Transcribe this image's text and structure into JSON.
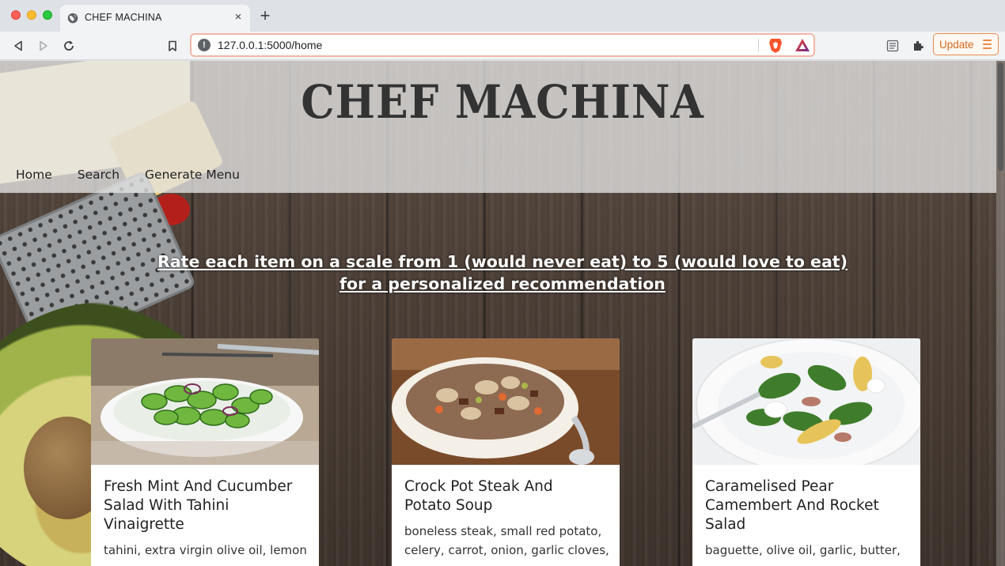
{
  "browser": {
    "tab_title": "CHEF MACHINA",
    "tab_close": "×",
    "new_tab": "+",
    "url": "127.0.0.1:5000/home",
    "update_label": "Update",
    "icons": [
      "back-icon",
      "forward-icon",
      "reload-icon",
      "bookmark-icon",
      "info-icon",
      "brave-shield-icon",
      "brave-rewards-icon",
      "reader-mode-icon",
      "extensions-icon",
      "menu-icon",
      "globe-icon"
    ]
  },
  "site": {
    "title": "CHEF MACHINA",
    "nav": [
      "Home",
      "Search",
      "Generate Menu"
    ]
  },
  "instructions": {
    "line1": "Rate each item on a scale from 1 (would never eat) to 5 (would love to eat)",
    "line2": "for a personalized recommendation"
  },
  "cards": [
    {
      "title": "Fresh Mint And Cucumber Salad With Tahini Vinaigrette",
      "ingredients": "tahini, extra virgin olive oil, lemon"
    },
    {
      "title": "Crock Pot Steak And Potato Soup",
      "ingredients": "boneless steak, small red potato, celery, carrot, onion, garlic cloves,"
    },
    {
      "title": "Caramelised Pear Camembert And Rocket Salad",
      "ingredients": "baguette, olive oil, garlic, butter,"
    }
  ],
  "colors": {
    "accent_update": "#d26a1f",
    "header_band": "#e4e4e4",
    "wood": "#4f4239"
  }
}
